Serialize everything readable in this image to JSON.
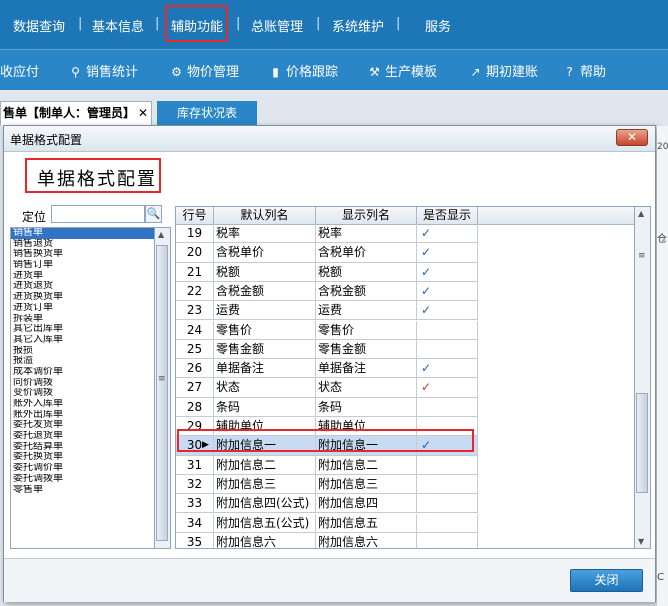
{
  "nav": [
    "数据查询",
    "基本信息",
    "辅助功能",
    "总账管理",
    "系统维护",
    "服务"
  ],
  "toolbar": [
    {
      "label": "收应付",
      "icon": ""
    },
    {
      "label": "销售统计",
      "icon": "search-icon"
    },
    {
      "label": "物价管理",
      "icon": "gear-icon"
    },
    {
      "label": "价格跟踪",
      "icon": "bar-chart-icon"
    },
    {
      "label": "生产模板",
      "icon": "wrench-icon"
    },
    {
      "label": "期初建账",
      "icon": "external-link-icon"
    },
    {
      "label": "帮助",
      "icon": "question-icon"
    }
  ],
  "tabs": {
    "active": "售单【制单人：管理员】",
    "close": "✕",
    "second": "库存状况表"
  },
  "dialog": {
    "title": "单据格式配置",
    "heading": "单据格式配置",
    "close_icon": "✕",
    "locate_label": "定位",
    "close_button": "关闭"
  },
  "left_list": [
    "销售单",
    "销售退货",
    "销售换货单",
    "销售订单",
    "进货单",
    "进货退货",
    "进货换货单",
    "进货订单",
    "拆装单",
    "其它出库单",
    "其它入库单",
    "报损",
    "报溢",
    "成本调价单",
    "同价调拨",
    "变价调拨",
    "账外入库单",
    "账外出库单",
    "委托发货单",
    "委托退货单",
    "委托结算单",
    "委托换货单",
    "委托调价单",
    "委托调拨单",
    "零售单"
  ],
  "grid": {
    "headers": [
      "行号",
      "默认列名",
      "显示列名",
      "是否显示"
    ],
    "rows": [
      {
        "no": "19",
        "default": "税率",
        "display": "税率",
        "show": "✓"
      },
      {
        "no": "20",
        "default": "含税单价",
        "display": "含税单价",
        "show": "✓"
      },
      {
        "no": "21",
        "default": "税额",
        "display": "税额",
        "show": "✓"
      },
      {
        "no": "22",
        "default": "含税金额",
        "display": "含税金额",
        "show": "✓"
      },
      {
        "no": "23",
        "default": "运费",
        "display": "运费",
        "show": "✓"
      },
      {
        "no": "24",
        "default": "零售价",
        "display": "零售价",
        "show": ""
      },
      {
        "no": "25",
        "default": "零售金额",
        "display": "零售金额",
        "show": ""
      },
      {
        "no": "26",
        "default": "单据备注",
        "display": "单据备注",
        "show": "✓"
      },
      {
        "no": "27",
        "default": "状态",
        "display": "状态",
        "show": "✓"
      },
      {
        "no": "28",
        "default": "条码",
        "display": "条码",
        "show": ""
      },
      {
        "no": "29",
        "default": "辅助单位",
        "display": "辅助单位",
        "show": ""
      },
      {
        "no": "30",
        "default": "附加信息一",
        "display": "附加信息一",
        "show": "✓"
      },
      {
        "no": "31",
        "default": "附加信息二",
        "display": "附加信息二",
        "show": ""
      },
      {
        "no": "32",
        "default": "附加信息三",
        "display": "附加信息三",
        "show": ""
      },
      {
        "no": "33",
        "default": "附加信息四(公式)",
        "display": "附加信息四",
        "show": ""
      },
      {
        "no": "34",
        "default": "附加信息五(公式)",
        "display": "附加信息五",
        "show": ""
      },
      {
        "no": "35",
        "default": "附加信息六",
        "display": "附加信息六",
        "show": ""
      }
    ]
  },
  "right_edge": {
    "top": "20",
    "mid": "仓",
    "bottom": "C"
  }
}
